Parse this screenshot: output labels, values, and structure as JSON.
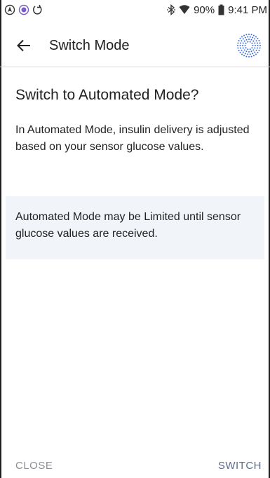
{
  "status_bar": {
    "battery": "90%",
    "time": "9:41 PM",
    "icons": [
      "navigation-icon",
      "record-icon",
      "sync-icon",
      "bluetooth-icon",
      "wifi-icon",
      "battery-icon"
    ]
  },
  "app_bar": {
    "title": "Switch Mode",
    "back_icon": "arrow-left-icon",
    "sensor_icon": "sensor-icon"
  },
  "content": {
    "heading": "Switch to Automated Mode?",
    "description": "In Automated Mode, insulin delivery is adjusted based on your sensor glucose values.",
    "info": "Automated Mode may be Limited until sensor glucose values are received."
  },
  "footer": {
    "close_label": "CLOSE",
    "switch_label": "SWITCH"
  },
  "colors": {
    "info_panel": "#f1f4f9",
    "close_text": "#8a8f95",
    "switch_text": "#5a6b85",
    "accent_blue": "#3b6fd8"
  }
}
